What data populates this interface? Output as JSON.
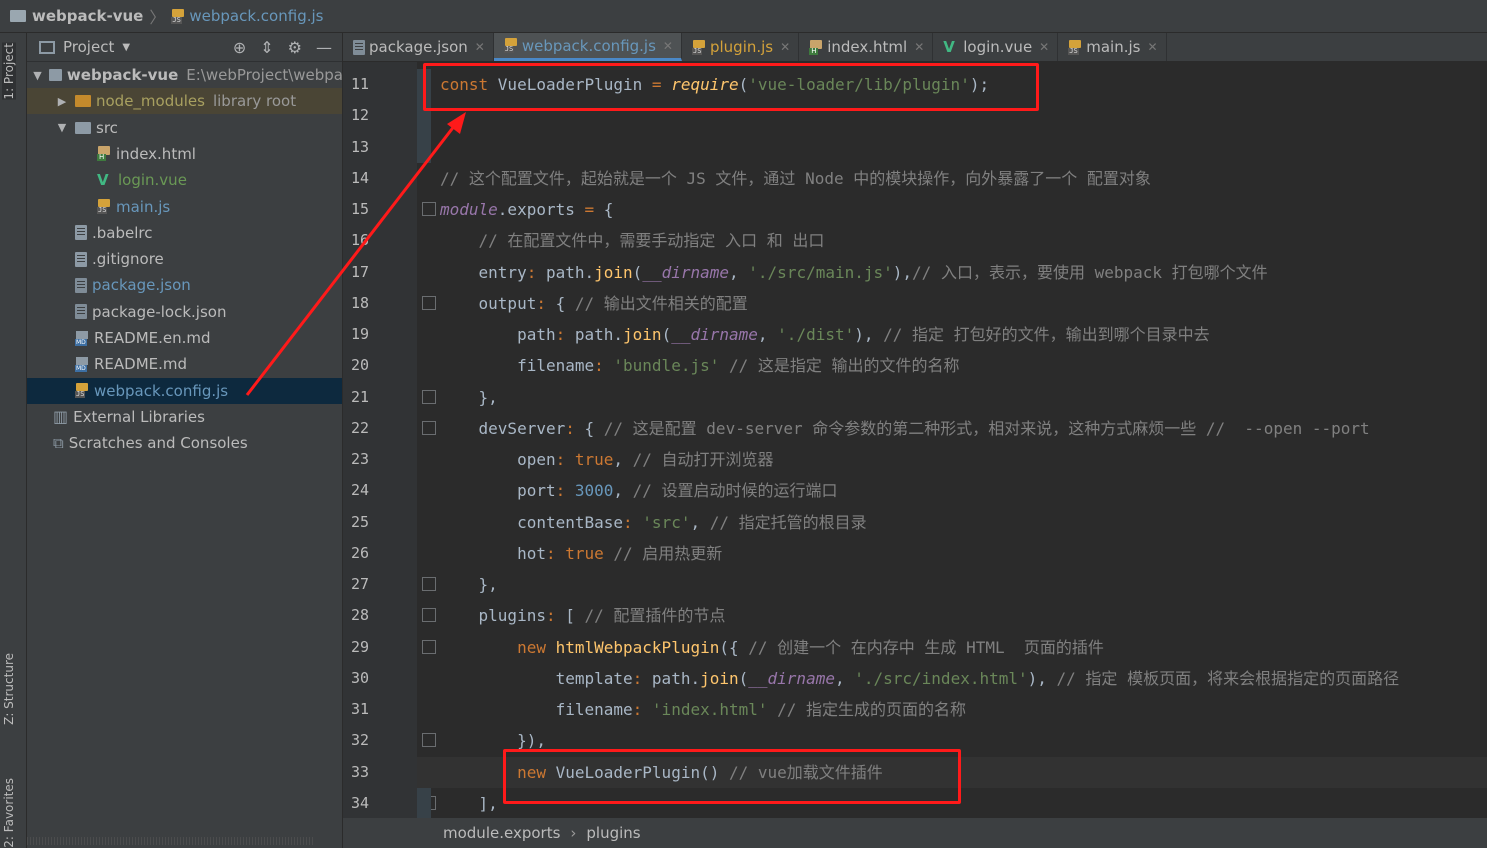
{
  "breadcrumb": {
    "project": "webpack-vue",
    "file": "webpack.config.js"
  },
  "tool_tabs": {
    "project": "1: Project",
    "structure": "Z: Structure",
    "favorites": "2: Favorites"
  },
  "project_panel": {
    "title": "Project",
    "tree": [
      {
        "label": "webpack-vue",
        "hint": "E:\\webProject\\webpa",
        "icon": "folder-icon",
        "color": "#bbbbbb",
        "bold": true,
        "level": 0,
        "arrow": "down"
      },
      {
        "label": "node_modules",
        "hint": "library root",
        "icon": "folder-orange-icon",
        "color": "#a8a060",
        "level": 1,
        "arrow": "right"
      },
      {
        "label": "src",
        "icon": "folder-icon",
        "color": "#bbbbbb",
        "level": 1,
        "arrow": "down"
      },
      {
        "label": "index.html",
        "icon": "html-file-icon",
        "color": "#bbbbbb",
        "level": 2
      },
      {
        "label": "login.vue",
        "icon": "vue-file-icon",
        "color": "#6a9955",
        "level": 2
      },
      {
        "label": "main.js",
        "icon": "js-file-icon",
        "color": "#6897bb",
        "level": 2
      },
      {
        "label": ".babelrc",
        "icon": "config-file-icon",
        "color": "#bbbbbb",
        "level": 1
      },
      {
        "label": ".gitignore",
        "icon": "text-file-icon",
        "color": "#bbbbbb",
        "level": 1
      },
      {
        "label": "package.json",
        "icon": "json-file-icon",
        "color": "#6897bb",
        "level": 1
      },
      {
        "label": "package-lock.json",
        "icon": "json-file-icon",
        "color": "#bbbbbb",
        "level": 1
      },
      {
        "label": "README.en.md",
        "icon": "markdown-file-icon",
        "color": "#bbbbbb",
        "level": 1
      },
      {
        "label": "README.md",
        "icon": "markdown-file-icon",
        "color": "#bbbbbb",
        "level": 1
      },
      {
        "label": "webpack.config.js",
        "icon": "js-file-icon",
        "color": "#6897bb",
        "level": 1,
        "selected": true
      },
      {
        "label": "External Libraries",
        "icon": "libraries-icon",
        "color": "#bbbbbb",
        "level": 0
      },
      {
        "label": "Scratches and Consoles",
        "icon": "scratches-icon",
        "color": "#bbbbbb",
        "level": 0
      }
    ]
  },
  "tabs": [
    {
      "label": "package.json",
      "icon": "json-file-icon",
      "color": "#bbbbbb",
      "active": false
    },
    {
      "label": "webpack.config.js",
      "icon": "js-file-icon",
      "color": "#6897bb",
      "active": true
    },
    {
      "label": "plugin.js",
      "icon": "js-file-icon",
      "color": "#d4a23a",
      "active": false
    },
    {
      "label": "index.html",
      "icon": "html-file-icon",
      "color": "#bbbbbb",
      "active": false
    },
    {
      "label": "login.vue",
      "icon": "vue-file-icon",
      "color": "#bbbbbb",
      "active": false
    },
    {
      "label": "main.js",
      "icon": "js-file-icon",
      "color": "#bbbbbb",
      "active": false
    }
  ],
  "editor": {
    "current_line": 33,
    "lines": [
      {
        "num": "11",
        "tokens": [
          [
            "k",
            "const "
          ],
          [
            "",
            "VueLoaderPlugin "
          ],
          [
            "k",
            "= "
          ],
          [
            "fn it",
            "require"
          ],
          [
            "",
            "("
          ],
          [
            "s",
            "'vue-loader/lib/plugin'"
          ],
          [
            "",
            ");"
          ]
        ]
      },
      {
        "num": "12",
        "tokens": []
      },
      {
        "num": "13",
        "tokens": []
      },
      {
        "num": "14",
        "tokens": [
          [
            "cm",
            "// 这个配置文件，起始就是一个 JS 文件，通过 Node 中的模块操作，向外暴露了一个 配置对象"
          ]
        ]
      },
      {
        "num": "15",
        "tokens": [
          [
            "prop it",
            "module"
          ],
          [
            "",
            ".exports "
          ],
          [
            "k",
            "= "
          ],
          [
            "",
            "{"
          ]
        ]
      },
      {
        "num": "16",
        "tokens": [
          [
            "",
            "    "
          ],
          [
            "cm",
            "// 在配置文件中，需要手动指定 入口 和 出口"
          ]
        ]
      },
      {
        "num": "17",
        "tokens": [
          [
            "",
            "    entry"
          ],
          [
            "k",
            ": "
          ],
          [
            "",
            "path."
          ],
          [
            "fn",
            "join"
          ],
          [
            "",
            "("
          ],
          [
            "prop it",
            "__dirname"
          ],
          [
            "",
            ", "
          ],
          [
            "s",
            "'./src/main.js'"
          ],
          [
            "",
            "),"
          ],
          [
            "cm",
            "// 入口，表示，要使用 webpack 打包哪个文件"
          ]
        ]
      },
      {
        "num": "18",
        "tokens": [
          [
            "",
            "    output"
          ],
          [
            "k",
            ": "
          ],
          [
            "",
            "{ "
          ],
          [
            "cm",
            "// 输出文件相关的配置"
          ]
        ]
      },
      {
        "num": "19",
        "tokens": [
          [
            "",
            "        path"
          ],
          [
            "k",
            ": "
          ],
          [
            "",
            "path."
          ],
          [
            "fn",
            "join"
          ],
          [
            "",
            "("
          ],
          [
            "prop it",
            "__dirname"
          ],
          [
            "",
            ", "
          ],
          [
            "s",
            "'./dist'"
          ],
          [
            "",
            "), "
          ],
          [
            "cm",
            "// 指定 打包好的文件，输出到哪个目录中去"
          ]
        ]
      },
      {
        "num": "20",
        "tokens": [
          [
            "",
            "        filename"
          ],
          [
            "k",
            ": "
          ],
          [
            "s",
            "'bundle.js'"
          ],
          [
            "cm",
            " // 这是指定 输出的文件的名称"
          ]
        ]
      },
      {
        "num": "21",
        "tokens": [
          [
            "",
            "    },"
          ]
        ]
      },
      {
        "num": "22",
        "tokens": [
          [
            "",
            "    devServer"
          ],
          [
            "k",
            ": "
          ],
          [
            "",
            "{ "
          ],
          [
            "cm",
            "// 这是配置 dev-server 命令参数的第二种形式，相对来说，这种方式麻烦一些 //  --open --port"
          ]
        ]
      },
      {
        "num": "23",
        "tokens": [
          [
            "",
            "        open"
          ],
          [
            "k",
            ": "
          ],
          [
            "k",
            "true"
          ],
          [
            "",
            ", "
          ],
          [
            "cm",
            "// 自动打开浏览器"
          ]
        ]
      },
      {
        "num": "24",
        "tokens": [
          [
            "",
            "        port"
          ],
          [
            "k",
            ": "
          ],
          [
            "n",
            "3000"
          ],
          [
            "",
            ", "
          ],
          [
            "cm",
            "// 设置启动时候的运行端口"
          ]
        ]
      },
      {
        "num": "25",
        "tokens": [
          [
            "",
            "        contentBase"
          ],
          [
            "k",
            ": "
          ],
          [
            "s",
            "'src'"
          ],
          [
            "",
            ", "
          ],
          [
            "cm",
            "// 指定托管的根目录"
          ]
        ]
      },
      {
        "num": "26",
        "tokens": [
          [
            "",
            "        hot"
          ],
          [
            "k",
            ": "
          ],
          [
            "k",
            "true"
          ],
          [
            "cm",
            " // 启用热更新"
          ]
        ]
      },
      {
        "num": "27",
        "tokens": [
          [
            "",
            "    },"
          ]
        ]
      },
      {
        "num": "28",
        "tokens": [
          [
            "",
            "    plugins"
          ],
          [
            "k",
            ": "
          ],
          [
            "",
            "[ "
          ],
          [
            "cm",
            "// 配置插件的节点"
          ]
        ]
      },
      {
        "num": "29",
        "tokens": [
          [
            "",
            "        "
          ],
          [
            "k",
            "new "
          ],
          [
            "fn",
            "htmlWebpackPlugin"
          ],
          [
            "",
            "({ "
          ],
          [
            "cm",
            "// 创建一个 在内存中 生成 HTML  页面的插件"
          ]
        ]
      },
      {
        "num": "30",
        "tokens": [
          [
            "",
            "            template"
          ],
          [
            "k",
            ": "
          ],
          [
            "",
            "path."
          ],
          [
            "fn",
            "join"
          ],
          [
            "",
            "("
          ],
          [
            "prop it",
            "__dirname"
          ],
          [
            "",
            ", "
          ],
          [
            "s",
            "'./src/index.html'"
          ],
          [
            "",
            "), "
          ],
          [
            "cm",
            "// 指定 模板页面，将来会根据指定的页面路径"
          ]
        ]
      },
      {
        "num": "31",
        "tokens": [
          [
            "",
            "            filename"
          ],
          [
            "k",
            ": "
          ],
          [
            "s",
            "'index.html'"
          ],
          [
            "cm",
            " // 指定生成的页面的名称"
          ]
        ]
      },
      {
        "num": "32",
        "tokens": [
          [
            "",
            "        }),"
          ]
        ]
      },
      {
        "num": "33",
        "tokens": [
          [
            "",
            "        "
          ],
          [
            "k",
            "new "
          ],
          [
            "",
            "VueLoaderPlugin() "
          ],
          [
            "cm",
            "// vue加载文件插件"
          ]
        ]
      },
      {
        "num": "34",
        "tokens": [
          [
            "",
            "    ],"
          ]
        ]
      }
    ]
  },
  "statusbar": {
    "crumb1": "module.exports",
    "crumb2": "plugins"
  },
  "colors": {
    "annotation": "#ff1a1a",
    "keyword": "#cc7832",
    "string": "#6a8759",
    "comment": "#808080",
    "function": "#ffc66d",
    "selection": "#0d293e"
  }
}
